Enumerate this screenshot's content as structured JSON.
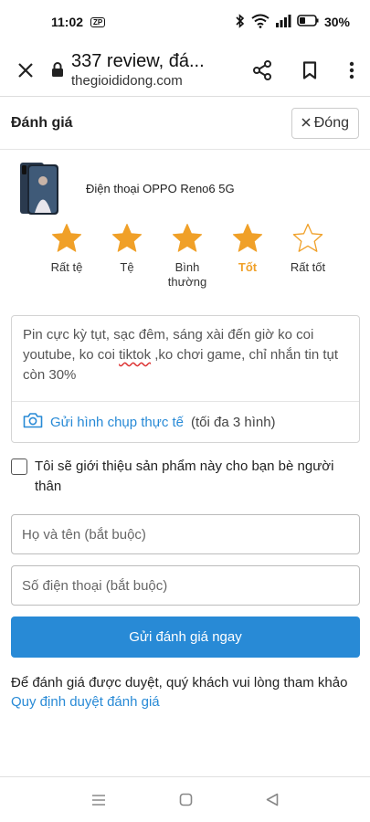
{
  "status": {
    "time": "11:02",
    "zp": "ZP",
    "battery": "30%"
  },
  "browser": {
    "title": "337 review, đá...",
    "domain": "thegioididong.com"
  },
  "form": {
    "heading": "Đánh giá",
    "close_label": "Đóng",
    "product_name": "Điện thoại OPPO Reno6 5G",
    "stars": [
      {
        "label": "Rất tệ",
        "filled": true
      },
      {
        "label": "Tệ",
        "filled": true
      },
      {
        "label": "Bình thường",
        "filled": true
      },
      {
        "label": "Tốt",
        "filled": true,
        "active": true
      },
      {
        "label": "Rất tốt",
        "filled": false
      }
    ],
    "review_before": "Pin cực kỳ tụt, sạc đêm, sáng xài đến giờ ko coi youtube, ko coi ",
    "review_spell": "tiktok",
    "review_after": " ,ko chơi game, chỉ nhắn tin tụt còn 30%",
    "photo_link": "Gửi hình chụp thực tế",
    "photo_limit": "(tối đa 3 hình)",
    "recommend": "Tôi sẽ giới thiệu sản phẩm này cho bạn bè người thân",
    "name_placeholder": "Họ và tên (bắt buộc)",
    "phone_placeholder": "Số điện thoại (bắt buộc)",
    "submit": "Gửi đánh giá ngay",
    "note_text": "Để đánh giá được duyệt, quý khách vui lòng tham khảo ",
    "note_link": "Quy định duyệt đánh giá"
  },
  "colors": {
    "accent": "#288ad6",
    "star": "#f0a028"
  }
}
